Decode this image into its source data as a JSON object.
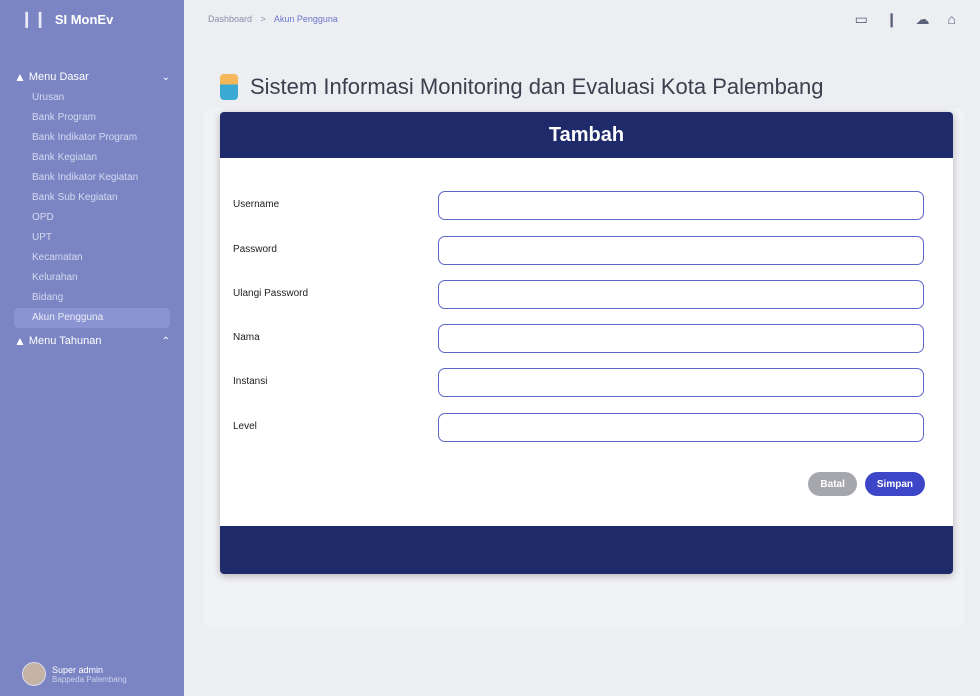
{
  "brand": {
    "name": "SI MonEv",
    "icon": "bar-chart-icon"
  },
  "sidebar": {
    "group1": {
      "label": "Menu Dasar"
    },
    "items": [
      {
        "label": "Urusan"
      },
      {
        "label": "Bank Program"
      },
      {
        "label": "Bank Indikator Program"
      },
      {
        "label": "Bank Kegiatan"
      },
      {
        "label": "Bank Indikator Kegiatan"
      },
      {
        "label": "Bank Sub Kegiatan"
      },
      {
        "label": "OPD"
      },
      {
        "label": "UPT"
      },
      {
        "label": "Kecamatan"
      },
      {
        "label": "Kelurahan"
      },
      {
        "label": "Bidang"
      },
      {
        "label": "Akun Pengguna",
        "active": true
      }
    ],
    "group2": {
      "label": "Menu Tahunan"
    }
  },
  "user": {
    "name": "Super admin",
    "org": "Bappeda Palembang"
  },
  "breadcrumb": {
    "home": "Dashboard",
    "current": "Akun Pengguna"
  },
  "page": {
    "title": "Sistem Informasi Monitoring dan Evaluasi Kota Palembang"
  },
  "modal": {
    "title": "Tambah",
    "fields": [
      {
        "label": "Username",
        "value": ""
      },
      {
        "label": "Password",
        "value": ""
      },
      {
        "label": "Ulangi Password",
        "value": ""
      },
      {
        "label": "Nama",
        "value": ""
      },
      {
        "label": "Instansi",
        "value": ""
      },
      {
        "label": "Level",
        "value": ""
      }
    ],
    "cancel_label": "Batal",
    "save_label": "Simpan"
  },
  "colors": {
    "sidebar": "#7b85c4",
    "modal_header": "#1e2a6a",
    "primary": "#3d46c6",
    "cancel": "#a5a7ad"
  }
}
